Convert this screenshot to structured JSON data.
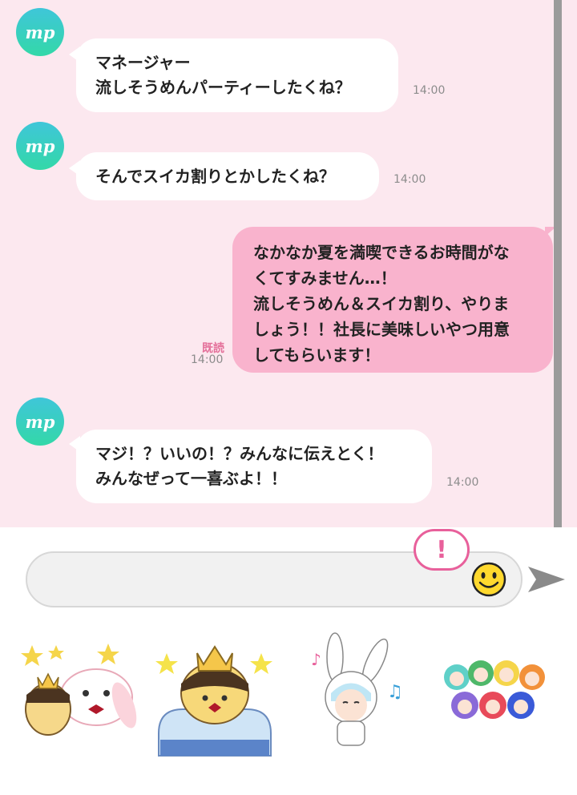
{
  "messages": [
    {
      "sender": "mp",
      "avatar_text": "mp",
      "text": "マネージャー\n流しそうめんパーティーしたくね？",
      "time": "14:00"
    },
    {
      "sender": "mp",
      "avatar_text": "mp",
      "text": "そんでスイカ割りとかしたくね？",
      "time": "14:00"
    },
    {
      "sender": "me",
      "text": "なかなか夏を満喫できるお時間がな\nくてすみません…！\n流しそうめん＆スイカ割り、やりま\nしょう！！社長に美味しいやつ用意\nしてもらいます！",
      "read": "既読",
      "time": "14:00"
    },
    {
      "sender": "mp",
      "avatar_text": "mp",
      "text": "マジ！？いいの！？みんなに伝えとく！\nみんなぜって一喜ぶよ！！",
      "time": "14:00"
    }
  ],
  "composer": {
    "input_value": "",
    "alert_icon": "exclamation-icon",
    "emoji_icon": "smiley-icon",
    "send_icon": "send-arrow-icon"
  },
  "stickers": [
    {
      "name": "crown-pudding-and-bunny-sticker"
    },
    {
      "name": "crowned-pudding-in-jar-sticker"
    },
    {
      "name": "bunny-hood-boy-sticker"
    },
    {
      "name": "group-hoodies-sticker"
    }
  ],
  "colors": {
    "chat_bg": "#fce8ef",
    "incoming_bubble": "#ffffff",
    "outgoing_bubble": "#f9b3cd",
    "read_text": "#e4709a",
    "avatar_gradient_top": "#3fc6d9",
    "avatar_gradient_bottom": "#33d8a8"
  }
}
